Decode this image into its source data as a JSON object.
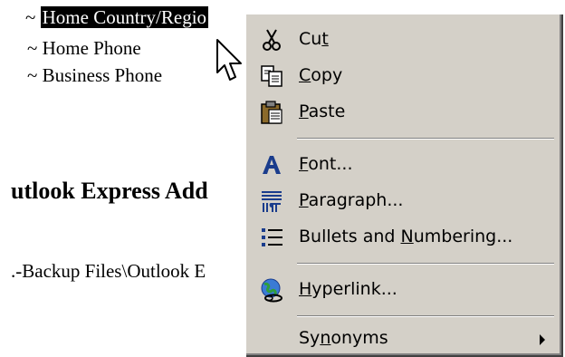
{
  "document": {
    "line1_prefix": "~ ",
    "line1_selected": "Home Country/Regio",
    "line2": "~ Home Phone",
    "line3": "~ Business Phone",
    "heading": "utlook Express Add",
    "path_text": ".-Backup Files\\Outlook E"
  },
  "context_menu": {
    "cut": {
      "pre": "Cu",
      "key": "t",
      "post": "",
      "icon": "scissors-icon"
    },
    "copy": {
      "pre": "",
      "key": "C",
      "post": "opy",
      "icon": "copy-icon"
    },
    "paste": {
      "pre": "",
      "key": "P",
      "post": "aste",
      "icon": "paste-icon"
    },
    "font": {
      "pre": "",
      "key": "F",
      "post": "ont...",
      "icon": "font-icon"
    },
    "paragraph": {
      "pre": "",
      "key": "P",
      "post": "aragraph...",
      "icon": "paragraph-icon"
    },
    "bullets": {
      "pre": "Bullets and ",
      "key": "N",
      "post": "umbering...",
      "icon": "bullets-icon"
    },
    "hyperlink": {
      "pre": "",
      "key": "H",
      "post": "yperlink...",
      "icon": "hyperlink-icon"
    },
    "synonyms": {
      "pre": "Sy",
      "key": "n",
      "post": "onyms",
      "icon": "submenu-arrow-icon"
    }
  },
  "colors": {
    "menu_bg": "#d4d0c8",
    "selection_bg": "#000000",
    "selection_fg": "#ffffff"
  }
}
